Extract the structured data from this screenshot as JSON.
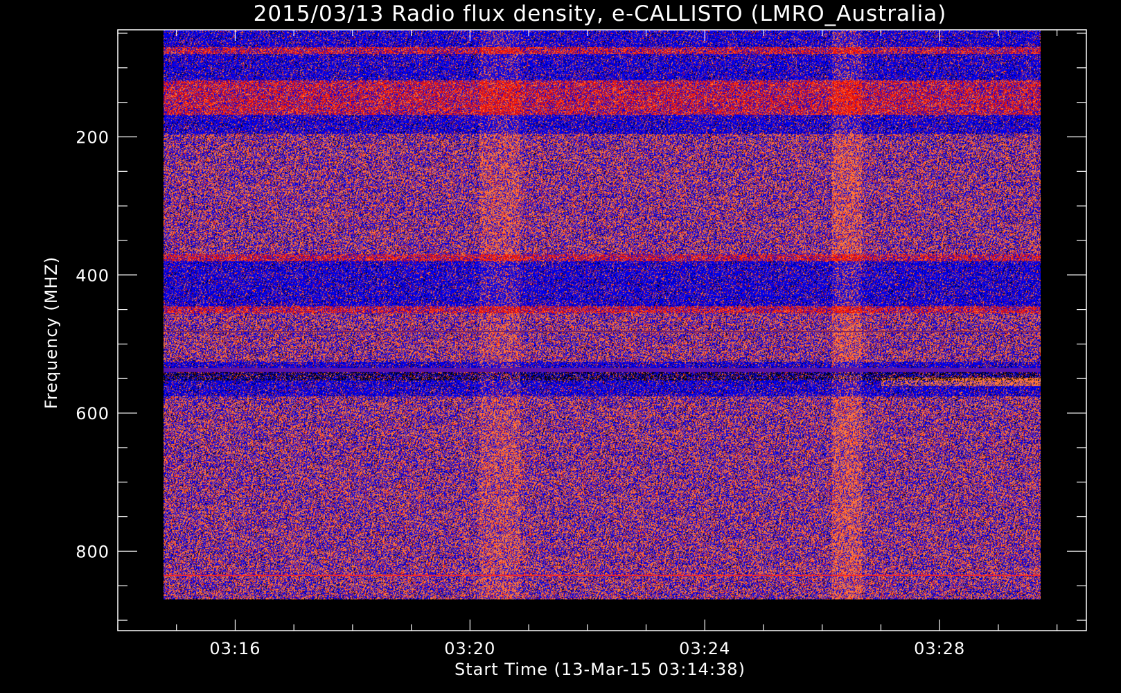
{
  "chart_data": {
    "type": "heatmap",
    "title": "2015/03/13  Radio flux density, e-CALLISTO (LMRO_Australia)",
    "xlabel": "Start Time (13-Mar-15 03:14:38)",
    "ylabel": "Frequency (MHZ)",
    "x_unit": "minutes",
    "x_range": [
      "03:14:38",
      "03:30:00"
    ],
    "xlim": [
      "03:14:00",
      "03:30:30"
    ],
    "ylim": [
      45,
      915
    ],
    "y_reversed": true,
    "data_extent": {
      "freq_min_mhz": 45,
      "freq_max_mhz": 870
    },
    "x_major_ticks": [
      {
        "label": "03:16",
        "value": "03:16"
      },
      {
        "label": "03:20",
        "value": "03:20"
      },
      {
        "label": "03:24",
        "value": "03:24"
      },
      {
        "label": "03:28",
        "value": "03:28"
      }
    ],
    "x_minor_tick_interval_min": 1,
    "y_major_ticks": [
      {
        "label": "200",
        "value": 200
      },
      {
        "label": "400",
        "value": 400
      },
      {
        "label": "600",
        "value": 600
      },
      {
        "label": "800",
        "value": 800
      }
    ],
    "y_minor_tick_interval_mhz": 50,
    "colormap": [
      "#000000",
      "#0000ff",
      "#ff0000",
      "#ff8040",
      "#ffffff"
    ],
    "bands_mhz": [
      {
        "from": 45,
        "to": 70,
        "level": "blue"
      },
      {
        "from": 70,
        "to": 80,
        "level": "red"
      },
      {
        "from": 80,
        "to": 118,
        "level": "blue"
      },
      {
        "from": 118,
        "to": 168,
        "level": "red"
      },
      {
        "from": 168,
        "to": 195,
        "level": "blue"
      },
      {
        "from": 195,
        "to": 370,
        "level": "mixed"
      },
      {
        "from": 370,
        "to": 380,
        "level": "red"
      },
      {
        "from": 380,
        "to": 445,
        "level": "blue"
      },
      {
        "from": 445,
        "to": 455,
        "level": "red"
      },
      {
        "from": 455,
        "to": 525,
        "level": "mixed"
      },
      {
        "from": 525,
        "to": 575,
        "level": "blue"
      },
      {
        "from": 575,
        "to": 870,
        "level": "mixed"
      }
    ],
    "burst_features": [
      {
        "time": "03:27-03:30",
        "freq_mhz": [
          548,
          560
        ],
        "level": "white-orange"
      }
    ],
    "background": "#000000",
    "axis_color": "#ffffff"
  }
}
